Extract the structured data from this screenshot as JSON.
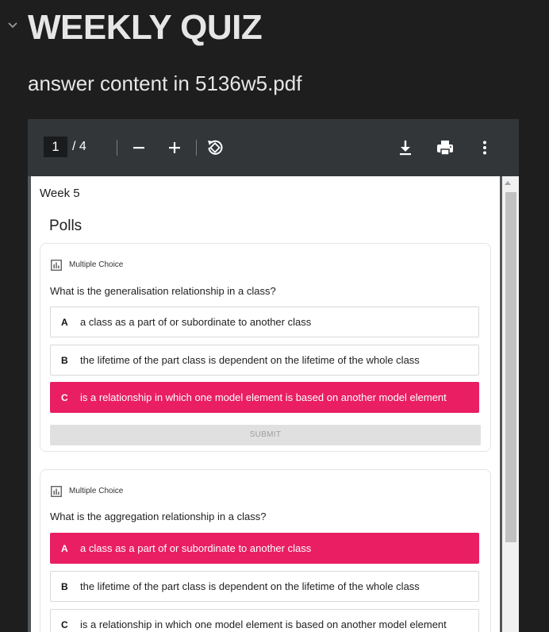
{
  "section": {
    "title": "WEEKLY QUIZ",
    "subtitle": "answer content in 5136w5.pdf"
  },
  "pdf_toolbar": {
    "current_page": "1",
    "total_pages": "/ 4",
    "icons": [
      "zoom-out-icon",
      "zoom-in-icon",
      "rotate-icon",
      "download-icon",
      "print-icon",
      "more-vert-icon"
    ]
  },
  "document": {
    "week_label": "Week 5",
    "polls_heading": "Polls",
    "polls": [
      {
        "type_label": "Multiple Choice",
        "question": "What is the generalisation relationship in a class?",
        "options": [
          {
            "letter": "A",
            "text": "a class as a part of or subordinate to another class",
            "selected": false
          },
          {
            "letter": "B",
            "text": "the lifetime of the part class is dependent on the lifetime of the whole class",
            "selected": false
          },
          {
            "letter": "C",
            "text": "is a relationship in which one model element is based on another model element",
            "selected": true
          }
        ],
        "submit_label": "SUBMIT"
      },
      {
        "type_label": "Multiple Choice",
        "question": "What is the aggregation relationship in a class?",
        "options": [
          {
            "letter": "A",
            "text": "a class as a part of or subordinate to another class",
            "selected": true
          },
          {
            "letter": "B",
            "text": "the lifetime of the part class is dependent on the lifetime of the whole class",
            "selected": false
          },
          {
            "letter": "C",
            "text": "is a relationship in which one model element is based on another model element",
            "selected": false
          }
        ]
      }
    ]
  },
  "colors": {
    "selected_option": "#e91e63",
    "toolbar_bg": "#323639",
    "page_bg": "#1e1e1e"
  }
}
